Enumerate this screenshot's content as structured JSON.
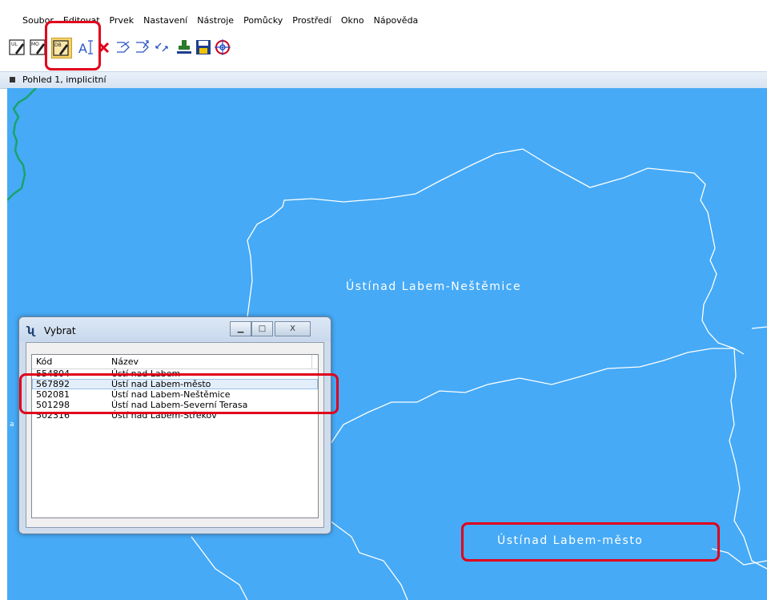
{
  "menu": {
    "items": [
      "Soubor",
      "Editovat",
      "Prvek",
      "Nastavení",
      "Nástroje",
      "Pomůcky",
      "Prostředí",
      "Okno",
      "Nápověda"
    ]
  },
  "toolbar": {
    "buttons": [
      "ul-edit-icon",
      "mo-edit-icon",
      "db-edit-icon",
      "text-cursor-icon",
      "delete-icon",
      "arrow-right-icon",
      "arrow-up-right-icon",
      "move-arrows-icon",
      "stamp-icon",
      "save-icon",
      "target-icon"
    ]
  },
  "view": {
    "title": "Pohled 1, implicitní"
  },
  "map": {
    "background_color": "#46aaf6",
    "boundary_color": "#ffffff",
    "river_color": "#1aa36a",
    "label_top": "Ústínad Labem-Neštěmice",
    "label_bottom": "Ústínad Labem-město",
    "edge_mark": "a"
  },
  "dialog": {
    "title": "Vybrat",
    "minimize": "▁",
    "maximize": "□",
    "close": "X",
    "columns": [
      "Kód",
      "Název"
    ],
    "rows": [
      {
        "code": "554804",
        "name": "Ústí nad Labem"
      },
      {
        "code": "567892",
        "name": "Ústí nad Labem-město",
        "selected": true
      },
      {
        "code": "502081",
        "name": "Ústí nad Labem-Neštěmice"
      },
      {
        "code": "501298",
        "name": "Ústí nad Labem-Severní Terasa"
      },
      {
        "code": "502316",
        "name": "Ústí nad Labem-Střekov"
      }
    ]
  },
  "highlight_color": "#e0001b"
}
